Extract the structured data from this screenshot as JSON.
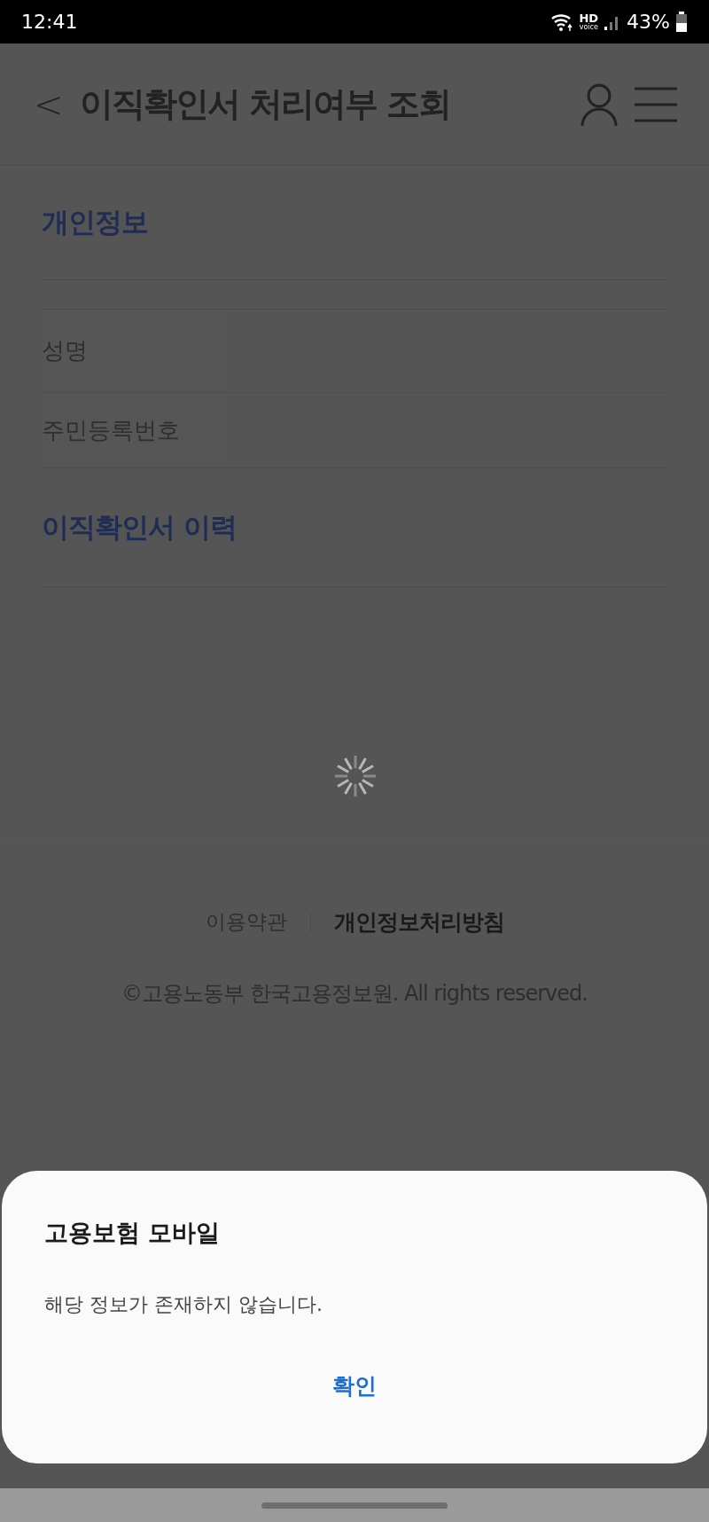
{
  "status_bar": {
    "time": "12:41",
    "hd": "HD",
    "voice": "voice",
    "battery": "43%"
  },
  "header": {
    "back": "<",
    "title": "이직확인서 처리여부 조회"
  },
  "personal_info": {
    "title": "개인정보",
    "rows": [
      {
        "label": "성명"
      },
      {
        "label": "주민등록번호"
      }
    ]
  },
  "history": {
    "title": "이직확인서 이력"
  },
  "footer": {
    "links": [
      {
        "label": "이용약관",
        "kind": "normal"
      },
      {
        "label": "개인정보처리방침",
        "kind": "strong"
      }
    ],
    "copyright": "©고용노동부 한국고용정보원. All rights reserved."
  },
  "dialog": {
    "title": "고용보험 모바일",
    "message": "해당 정보가 존재하지 않습니다.",
    "button": "확인"
  }
}
